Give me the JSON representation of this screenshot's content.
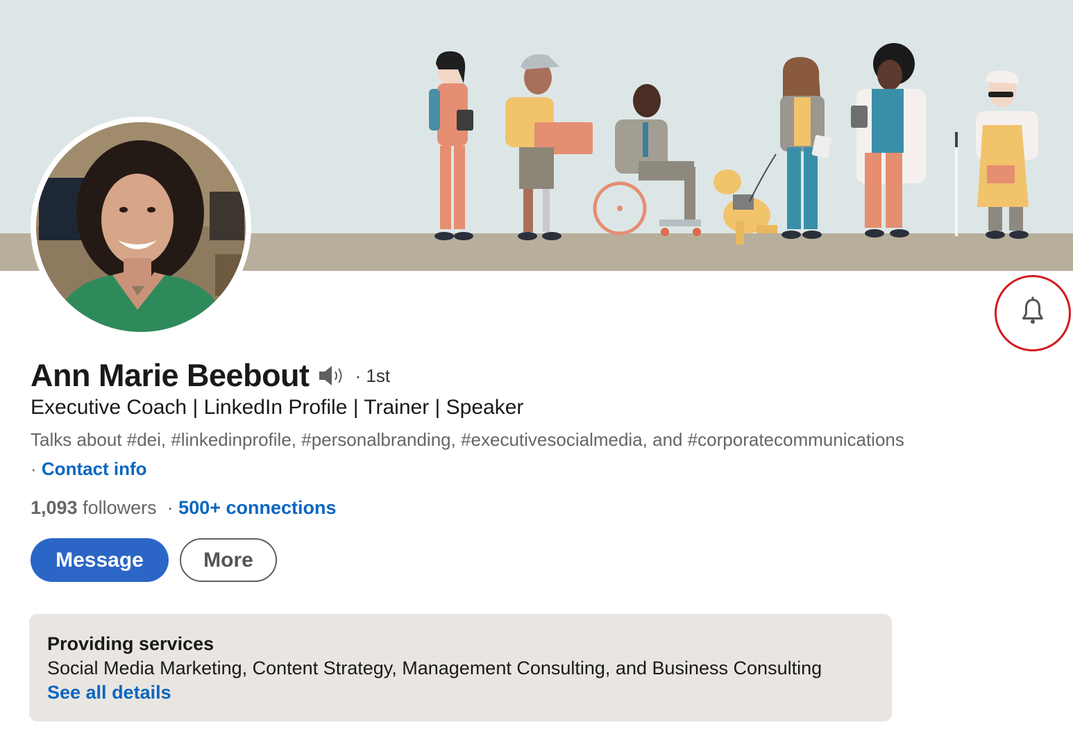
{
  "profile": {
    "name": "Ann Marie Beebout",
    "degree": "· 1st",
    "headline": "Executive Coach | LinkedIn Profile | Trainer | Speaker",
    "talks_about": "Talks about #dei, #linkedinprofile, #personalbranding, #executivesocialmedia, and #corporatecommunications",
    "contact_separator": "·",
    "contact_info_label": "Contact info",
    "followers_count": "1,093",
    "followers_label": "followers",
    "connections_separator": "·",
    "connections_label": "500+ connections"
  },
  "actions": {
    "message_label": "Message",
    "more_label": "More"
  },
  "services": {
    "title": "Providing services",
    "list": "Social Media Marketing, Content Strategy, Management Consulting, and Business Consulting",
    "details_link": "See all details"
  },
  "icons": {
    "notification": "bell-icon",
    "pronunciation": "speaker-icon"
  },
  "colors": {
    "accent_blue": "#0a66c2",
    "button_blue": "#2b66c6",
    "highlight_circle": "#d3191e",
    "banner_sky": "#dde6e6",
    "banner_ground": "#b8ae9c",
    "services_bg": "#e9e6e1"
  }
}
